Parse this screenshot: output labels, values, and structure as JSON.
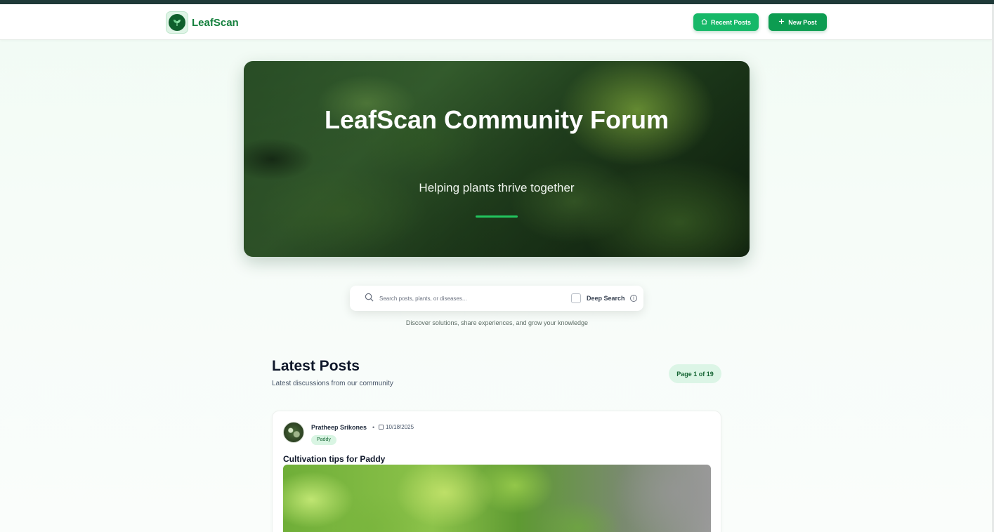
{
  "app": {
    "name": "LeafScan"
  },
  "nav": {
    "recent_label": "Recent Posts",
    "new_post_label": "New Post"
  },
  "hero": {
    "title": "LeafScan Community Forum",
    "subtitle": "Helping plants thrive together"
  },
  "search": {
    "placeholder": "Search posts, plants, or diseases...",
    "value": "",
    "deep_search_label": "Deep Search",
    "deep_search_checked": false,
    "tagline": "Discover solutions, share experiences, and grow your knowledge"
  },
  "latest": {
    "title": "Latest Posts",
    "subtitle": "Latest discussions from our community",
    "page_label": "Page 1 of 19"
  },
  "posts": [
    {
      "author": "Pratheep Srikones",
      "separator": "•",
      "date": "10/18/2025",
      "tag": "Paddy",
      "title": "Cultivation tips for Paddy"
    }
  ],
  "colors": {
    "brand": "#15803d",
    "accent": "#16b868",
    "accent_dark": "#0d9c51",
    "hero_bar": "#22c55e"
  },
  "icons": {
    "brand": "leaf-icon",
    "recent": "home-icon",
    "new": "plus-icon",
    "search": "search-icon",
    "info": "info-icon",
    "date": "calendar-icon"
  }
}
